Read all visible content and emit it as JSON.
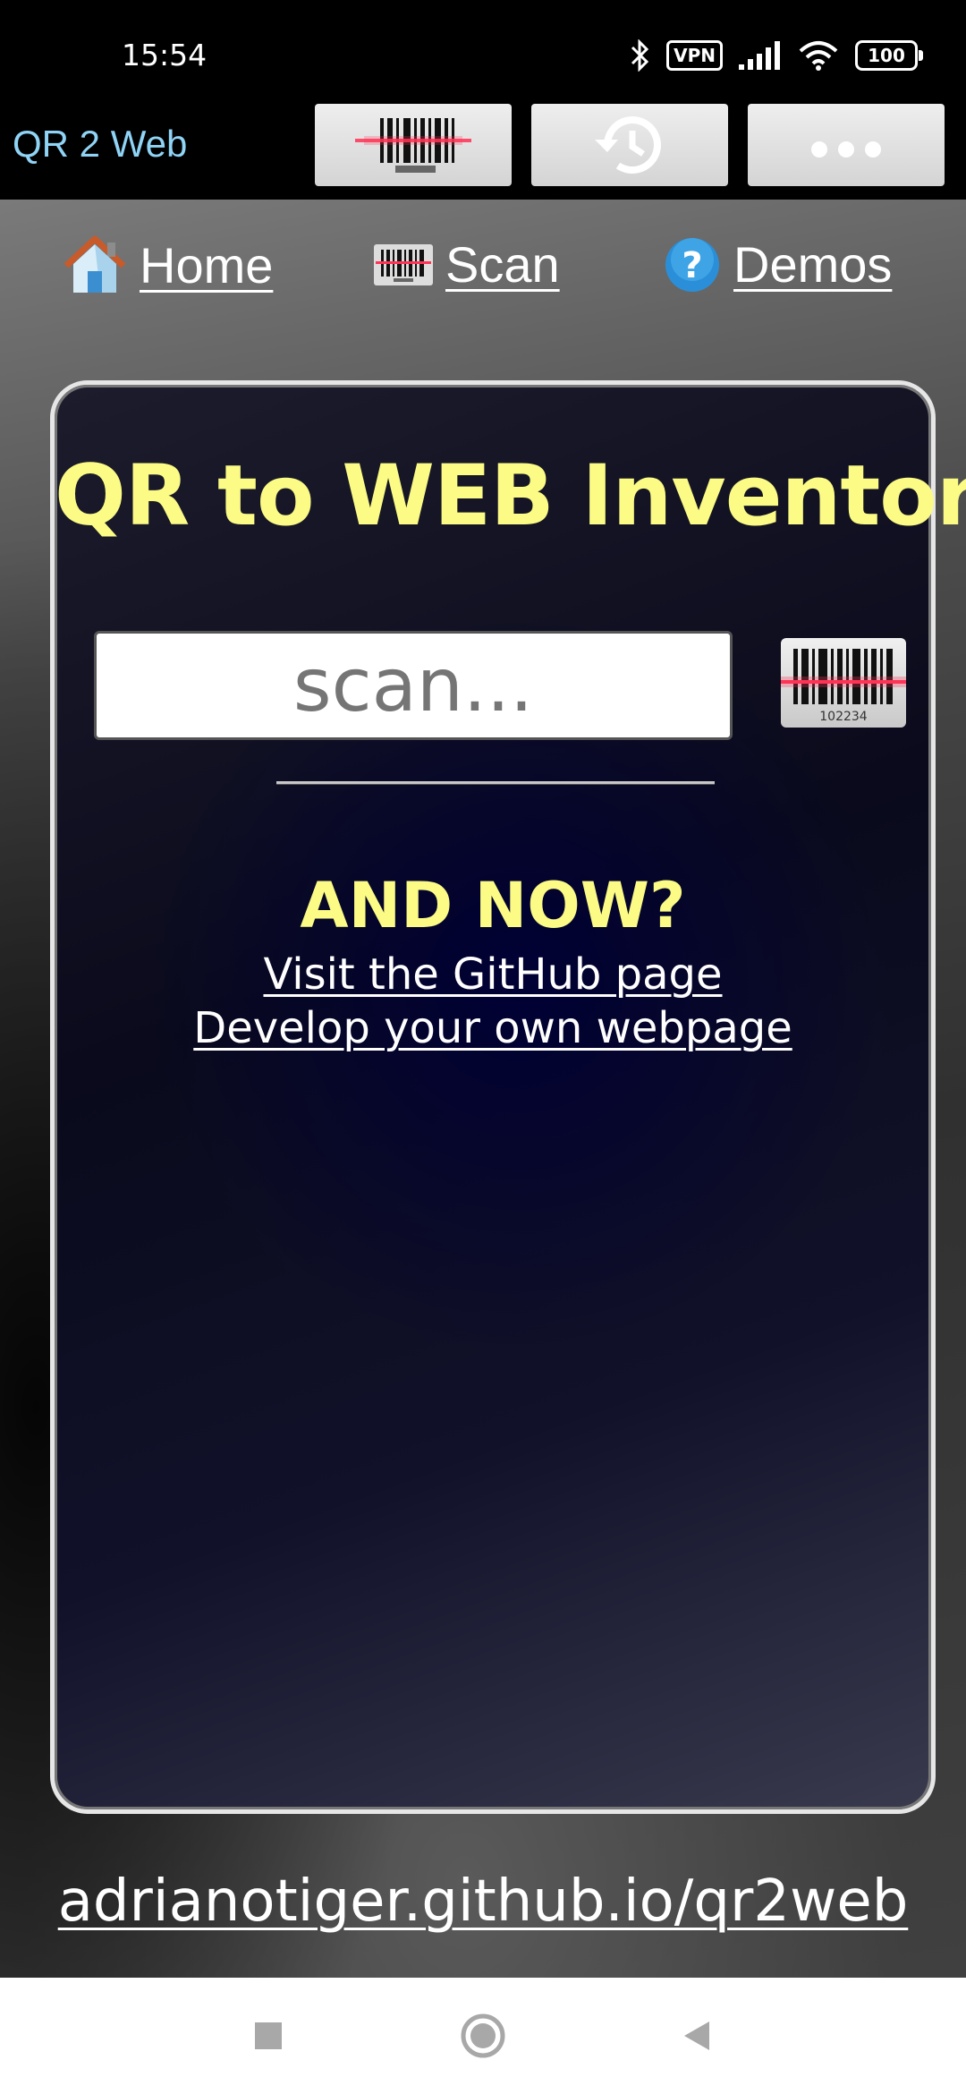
{
  "status_bar": {
    "time": "15:54",
    "vpn_label": "VPN",
    "battery_level": "100",
    "icons": [
      "bluetooth-icon",
      "vpn-icon",
      "signal-icon",
      "wifi-icon",
      "battery-icon"
    ]
  },
  "app_bar": {
    "title": "QR 2 Web",
    "buttons": [
      {
        "name": "scan-barcode-button",
        "icon": "barcode-icon"
      },
      {
        "name": "history-button",
        "icon": "history-icon"
      },
      {
        "name": "more-options-button",
        "icon": "more-dots-icon"
      }
    ]
  },
  "nav": {
    "items": [
      {
        "label": "Home",
        "icon": "home-icon"
      },
      {
        "label": "Scan",
        "icon": "barcode-icon"
      },
      {
        "label": "Demos",
        "icon": "help-icon"
      }
    ]
  },
  "card": {
    "title": "QR to WEB Inventory",
    "scan_input_placeholder": "scan...",
    "barcode_number": "102234",
    "and_now_heading": "AND NOW?",
    "links": [
      "Visit the GitHub page",
      "Develop your own webpage"
    ]
  },
  "footer": {
    "link": "adrianotiger.github.io/qr2web"
  },
  "system_nav": {
    "buttons": [
      "recents-button",
      "home-button",
      "back-button"
    ]
  },
  "colors": {
    "accent_yellow": "#fbfb85",
    "app_title_blue": "#8fd3f5",
    "laser_red": "#ff3355"
  }
}
